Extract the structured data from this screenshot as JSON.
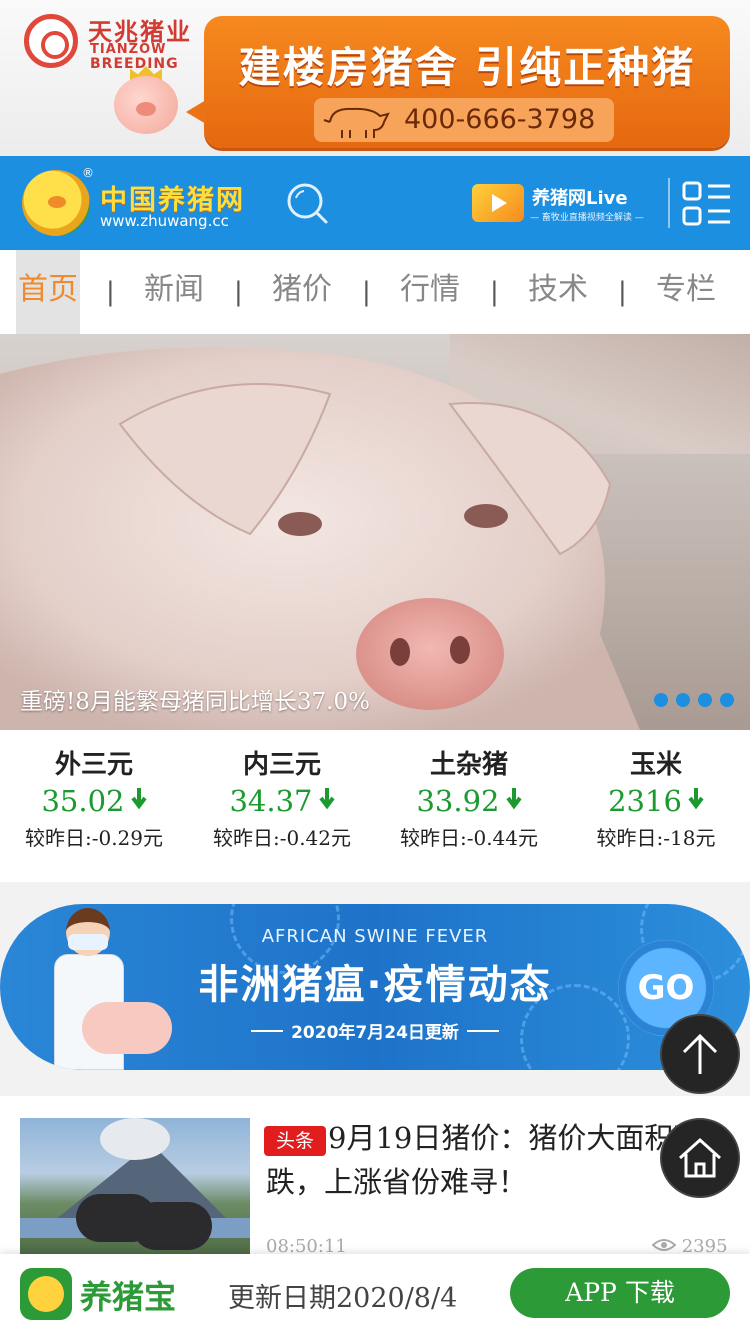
{
  "ad": {
    "brand_cn": "天兆猪业",
    "brand_en_1": "TIANZOW",
    "brand_en_2": "BREEDING",
    "headline": "建楼房猪舍 引纯正种猪",
    "phone": "400-666-3798"
  },
  "header": {
    "site_name": "中国养猪网",
    "site_url": "www.zhuwang.cc",
    "reg_mark": "®",
    "live_title": "养猪网Live",
    "live_subtitle": "— 畜牧业直播视频全解读 —"
  },
  "nav": {
    "items": [
      {
        "label": "首页",
        "active": true
      },
      {
        "label": "新闻",
        "active": false
      },
      {
        "label": "猪价",
        "active": false
      },
      {
        "label": "行情",
        "active": false
      },
      {
        "label": "技术",
        "active": false
      },
      {
        "label": "专栏",
        "active": false
      }
    ],
    "separator": "|"
  },
  "slider": {
    "caption": "重磅!8月能繁母猪同比增长37.0%",
    "dot_count": 4
  },
  "prices": [
    {
      "name": "外三元",
      "value": "35.02",
      "delta": "较昨日:-0.29元",
      "trend": "down"
    },
    {
      "name": "内三元",
      "value": "34.37",
      "delta": "较昨日:-0.42元",
      "trend": "down"
    },
    {
      "name": "土杂猪",
      "value": "33.92",
      "delta": "较昨日:-0.44元",
      "trend": "down"
    },
    {
      "name": "玉米",
      "value": "2316",
      "delta": "较昨日:-18元",
      "trend": "down"
    }
  ],
  "asf_banner": {
    "title_en": "AFRICAN SWINE FEVER",
    "title_cn": "非洲猪瘟·疫情动态",
    "updated": "2020年7月24日更新",
    "go_label": "GO"
  },
  "news": {
    "tag": "头条",
    "title": "9月19日猪价：猪价大面积下跌，上涨省份难寻！",
    "time": "08:50:11",
    "views": "2395"
  },
  "bottom_bar": {
    "app_name": "养猪宝",
    "update_date": "更新日期2020/8/4",
    "download_label": "APP 下载"
  },
  "colors": {
    "header_blue": "#1d8fe0",
    "nav_active": "#f08a2c",
    "price_green": "#1c9a2f",
    "tag_red": "#e11d1d",
    "app_green": "#2c9a36"
  },
  "icons": {
    "search": "search-icon",
    "menu": "grid-menu-icon",
    "arrow_down": "arrow-down-icon",
    "back_to_top": "arrow-up-icon",
    "home": "home-icon",
    "views": "eye-icon",
    "live_play": "play-icon"
  }
}
